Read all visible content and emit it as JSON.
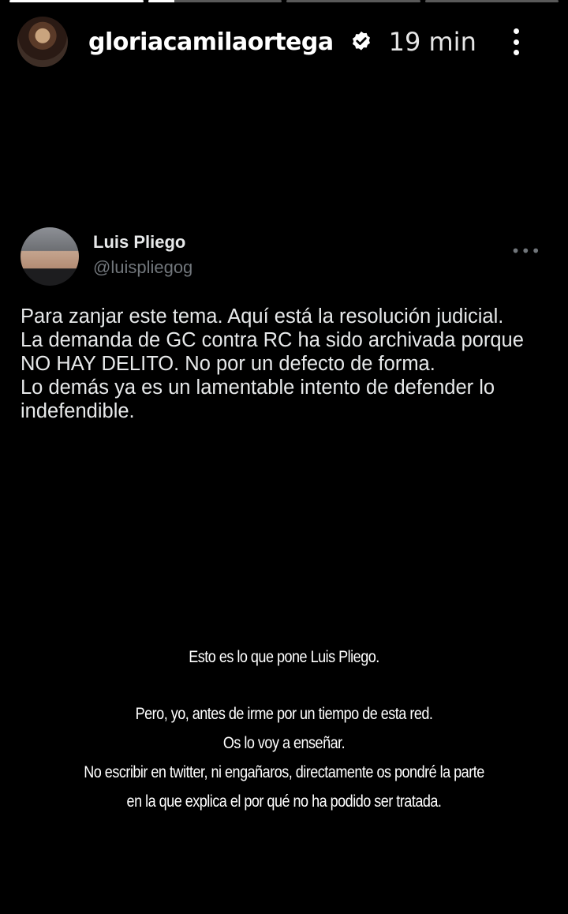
{
  "story": {
    "progress": [
      1.0,
      0.2,
      0.0,
      0.0
    ],
    "username": "gloriacamilaortega",
    "time": "19 min",
    "verified_icon": "verified-badge-icon",
    "more_icon": "more-vertical-icon"
  },
  "tweet": {
    "name": "Luis Pliego",
    "handle": "@luispliegog",
    "more": "•••",
    "text": "Para zanjar este tema. Aquí está la resolución judicial.\nLa demanda de GC contra RC ha sido archivada porque NO HAY DELITO. No por un defecto de forma.\nLo demás ya es un lamentable intento de defender lo indefendible."
  },
  "caption": {
    "line1": "Esto es lo que pone Luis Pliego.",
    "line2": "Pero, yo, antes de irme por un tiempo de esta red.",
    "line3": "Os lo voy a enseñar.",
    "line4": "No escribir en twitter, ni engañaros, directamente os pondré la parte",
    "line5": "en la que explica el por qué no ha podido ser tratada."
  }
}
